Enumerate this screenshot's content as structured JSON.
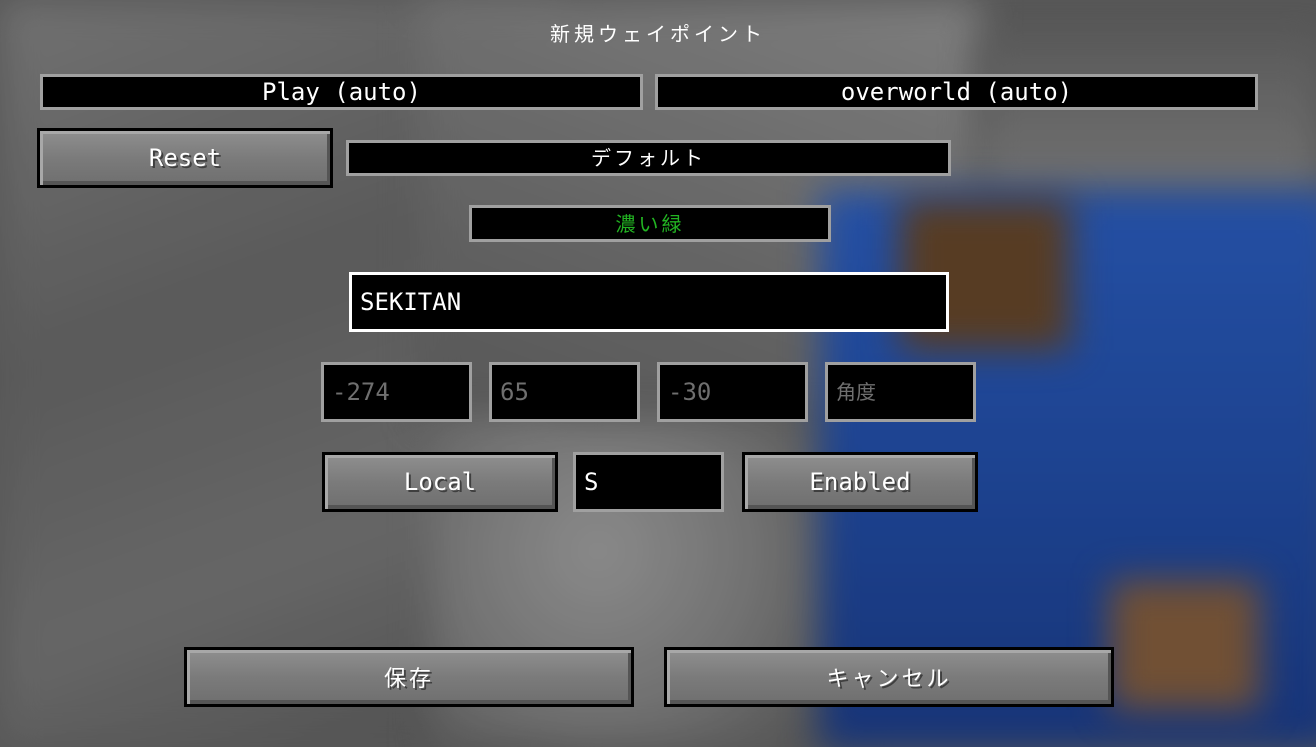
{
  "title": "新規ウェイポイント",
  "world": {
    "server": "Play (auto)",
    "dimension": "overworld (auto)"
  },
  "set": {
    "reset_label": "Reset",
    "name": "デフォルト"
  },
  "color": {
    "label": "濃い緑",
    "hex": "#22b322"
  },
  "waypoint": {
    "name": "SEKITAN"
  },
  "coords": {
    "x": "-274",
    "y": "65",
    "z": "-30",
    "angle_placeholder": "角度"
  },
  "options": {
    "visibility": "Local",
    "initials": "S",
    "enabled": "Enabled"
  },
  "footer": {
    "save": "保存",
    "cancel": "キャンセル"
  }
}
